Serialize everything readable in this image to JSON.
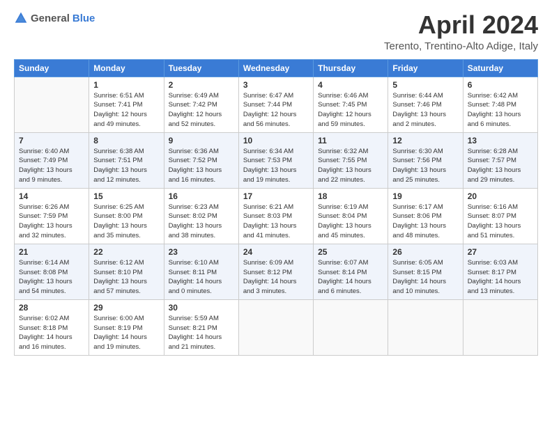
{
  "header": {
    "logo_general": "General",
    "logo_blue": "Blue",
    "title": "April 2024",
    "subtitle": "Terento, Trentino-Alto Adige, Italy"
  },
  "days_of_week": [
    "Sunday",
    "Monday",
    "Tuesday",
    "Wednesday",
    "Thursday",
    "Friday",
    "Saturday"
  ],
  "weeks": [
    [
      {
        "day": "",
        "info": ""
      },
      {
        "day": "1",
        "info": "Sunrise: 6:51 AM\nSunset: 7:41 PM\nDaylight: 12 hours\nand 49 minutes."
      },
      {
        "day": "2",
        "info": "Sunrise: 6:49 AM\nSunset: 7:42 PM\nDaylight: 12 hours\nand 52 minutes."
      },
      {
        "day": "3",
        "info": "Sunrise: 6:47 AM\nSunset: 7:44 PM\nDaylight: 12 hours\nand 56 minutes."
      },
      {
        "day": "4",
        "info": "Sunrise: 6:46 AM\nSunset: 7:45 PM\nDaylight: 12 hours\nand 59 minutes."
      },
      {
        "day": "5",
        "info": "Sunrise: 6:44 AM\nSunset: 7:46 PM\nDaylight: 13 hours\nand 2 minutes."
      },
      {
        "day": "6",
        "info": "Sunrise: 6:42 AM\nSunset: 7:48 PM\nDaylight: 13 hours\nand 6 minutes."
      }
    ],
    [
      {
        "day": "7",
        "info": "Sunrise: 6:40 AM\nSunset: 7:49 PM\nDaylight: 13 hours\nand 9 minutes."
      },
      {
        "day": "8",
        "info": "Sunrise: 6:38 AM\nSunset: 7:51 PM\nDaylight: 13 hours\nand 12 minutes."
      },
      {
        "day": "9",
        "info": "Sunrise: 6:36 AM\nSunset: 7:52 PM\nDaylight: 13 hours\nand 16 minutes."
      },
      {
        "day": "10",
        "info": "Sunrise: 6:34 AM\nSunset: 7:53 PM\nDaylight: 13 hours\nand 19 minutes."
      },
      {
        "day": "11",
        "info": "Sunrise: 6:32 AM\nSunset: 7:55 PM\nDaylight: 13 hours\nand 22 minutes."
      },
      {
        "day": "12",
        "info": "Sunrise: 6:30 AM\nSunset: 7:56 PM\nDaylight: 13 hours\nand 25 minutes."
      },
      {
        "day": "13",
        "info": "Sunrise: 6:28 AM\nSunset: 7:57 PM\nDaylight: 13 hours\nand 29 minutes."
      }
    ],
    [
      {
        "day": "14",
        "info": "Sunrise: 6:26 AM\nSunset: 7:59 PM\nDaylight: 13 hours\nand 32 minutes."
      },
      {
        "day": "15",
        "info": "Sunrise: 6:25 AM\nSunset: 8:00 PM\nDaylight: 13 hours\nand 35 minutes."
      },
      {
        "day": "16",
        "info": "Sunrise: 6:23 AM\nSunset: 8:02 PM\nDaylight: 13 hours\nand 38 minutes."
      },
      {
        "day": "17",
        "info": "Sunrise: 6:21 AM\nSunset: 8:03 PM\nDaylight: 13 hours\nand 41 minutes."
      },
      {
        "day": "18",
        "info": "Sunrise: 6:19 AM\nSunset: 8:04 PM\nDaylight: 13 hours\nand 45 minutes."
      },
      {
        "day": "19",
        "info": "Sunrise: 6:17 AM\nSunset: 8:06 PM\nDaylight: 13 hours\nand 48 minutes."
      },
      {
        "day": "20",
        "info": "Sunrise: 6:16 AM\nSunset: 8:07 PM\nDaylight: 13 hours\nand 51 minutes."
      }
    ],
    [
      {
        "day": "21",
        "info": "Sunrise: 6:14 AM\nSunset: 8:08 PM\nDaylight: 13 hours\nand 54 minutes."
      },
      {
        "day": "22",
        "info": "Sunrise: 6:12 AM\nSunset: 8:10 PM\nDaylight: 13 hours\nand 57 minutes."
      },
      {
        "day": "23",
        "info": "Sunrise: 6:10 AM\nSunset: 8:11 PM\nDaylight: 14 hours\nand 0 minutes."
      },
      {
        "day": "24",
        "info": "Sunrise: 6:09 AM\nSunset: 8:12 PM\nDaylight: 14 hours\nand 3 minutes."
      },
      {
        "day": "25",
        "info": "Sunrise: 6:07 AM\nSunset: 8:14 PM\nDaylight: 14 hours\nand 6 minutes."
      },
      {
        "day": "26",
        "info": "Sunrise: 6:05 AM\nSunset: 8:15 PM\nDaylight: 14 hours\nand 10 minutes."
      },
      {
        "day": "27",
        "info": "Sunrise: 6:03 AM\nSunset: 8:17 PM\nDaylight: 14 hours\nand 13 minutes."
      }
    ],
    [
      {
        "day": "28",
        "info": "Sunrise: 6:02 AM\nSunset: 8:18 PM\nDaylight: 14 hours\nand 16 minutes."
      },
      {
        "day": "29",
        "info": "Sunrise: 6:00 AM\nSunset: 8:19 PM\nDaylight: 14 hours\nand 19 minutes."
      },
      {
        "day": "30",
        "info": "Sunrise: 5:59 AM\nSunset: 8:21 PM\nDaylight: 14 hours\nand 21 minutes."
      },
      {
        "day": "",
        "info": ""
      },
      {
        "day": "",
        "info": ""
      },
      {
        "day": "",
        "info": ""
      },
      {
        "day": "",
        "info": ""
      }
    ]
  ],
  "accent_color": "#3a7bd5"
}
